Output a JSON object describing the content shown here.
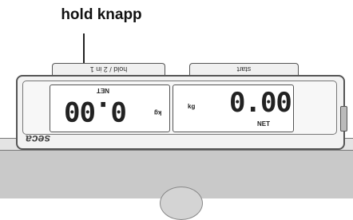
{
  "callout": {
    "title": "hold knapp"
  },
  "tabs": {
    "hold": "hold / 2 in 1",
    "start": "start"
  },
  "left_display": {
    "value": "0.00",
    "tag": "NET",
    "unit": "kg"
  },
  "right_display": {
    "value": "0.00",
    "tag": "NET",
    "unit": "kg"
  },
  "brand": {
    "logo": "seca"
  }
}
